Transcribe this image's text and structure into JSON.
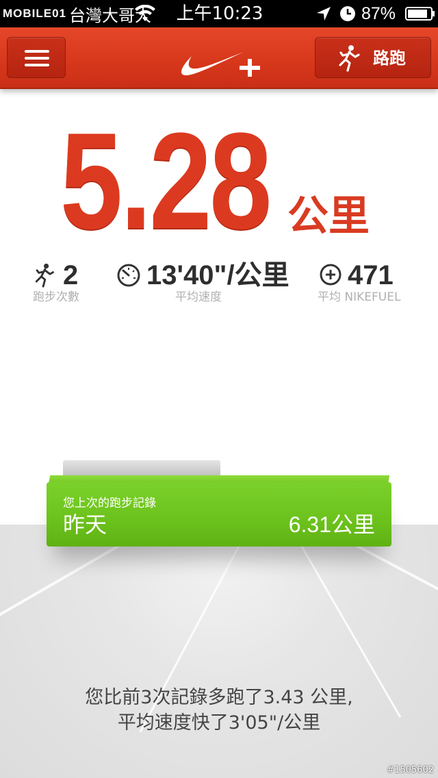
{
  "status_bar": {
    "carrier_logo": "MOBILE01",
    "carrier_name": "台灣大哥大",
    "time": "上午10:23",
    "battery": "87%"
  },
  "nav": {
    "run_label": "路跑"
  },
  "run": {
    "distance": "5.28",
    "distance_unit": "公里"
  },
  "stats": [
    {
      "value": "2",
      "label": "跑步次數",
      "icon": "runner-icon"
    },
    {
      "value": "13'40\"/公里",
      "label": "平均速度",
      "icon": "speedometer-icon"
    },
    {
      "value": "471",
      "label": "平均 NIKEFUEL",
      "icon": "fuel-plus-icon"
    }
  ],
  "last_record": {
    "caption": "您上次的跑步記錄",
    "day": "昨天",
    "distance": "6.31公里"
  },
  "summary": {
    "line1": "您比前3次記錄多跑了3.43 公里,",
    "line2": "平均速度快了3'05\"/公里"
  },
  "watermark": "#1505602",
  "colors": {
    "nav_red": "#d8381c",
    "distance_red": "#dc3a20",
    "card_green": "#6cc21c"
  }
}
